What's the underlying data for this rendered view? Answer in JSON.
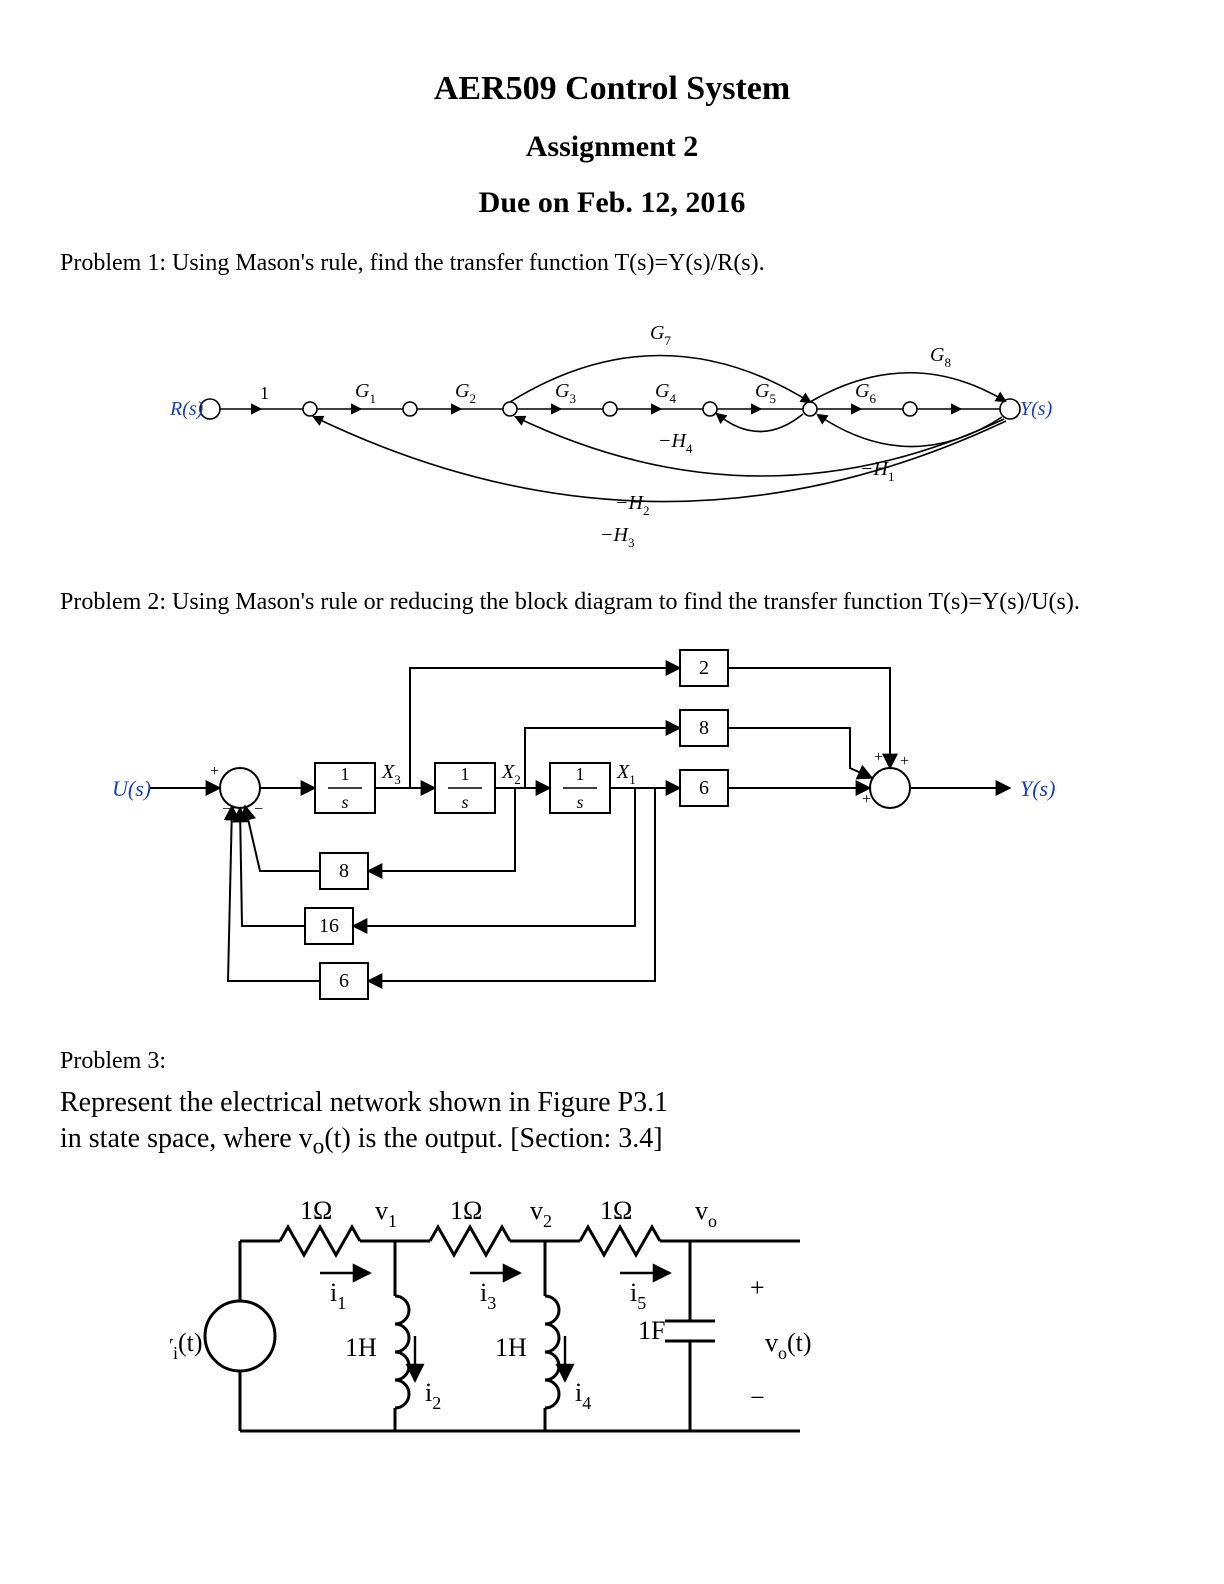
{
  "header": {
    "course": "AER509 Control System",
    "assign": "Assignment 2",
    "due": "Due on Feb. 12, 2016"
  },
  "problem1": {
    "text": "Problem 1:  Using Mason's rule, find the transfer function T(s)=Y(s)/R(s).",
    "labels": {
      "Rs": "R(s)",
      "Ys": "Y(s)",
      "one": "1",
      "G1": "G",
      "G1s": "1",
      "G2": "G",
      "G2s": "2",
      "G3": "G",
      "G3s": "3",
      "G4": "G",
      "G4s": "4",
      "G5": "G",
      "G5s": "5",
      "G6": "G",
      "G6s": "6",
      "G7": "G",
      "G7s": "7",
      "G8": "G",
      "G8s": "8",
      "mH1": "−H",
      "mH1s": "1",
      "mH2": "−H",
      "mH2s": "2",
      "mH3": "−H",
      "mH3s": "3",
      "mH4": "−H",
      "mH4s": "4"
    }
  },
  "problem2": {
    "text": "Problem 2: Using Mason's rule or reducing the block diagram to find the transfer function T(s)=Y(s)/U(s).",
    "labels": {
      "Us": "U(s)",
      "Ys": "Y(s)",
      "int": "1",
      "ints": "s",
      "X1": "X",
      "X1s": "1",
      "X2": "X",
      "X2s": "2",
      "X3": "X",
      "X3s": "3",
      "b8": "8",
      "b16": "16",
      "b6": "6",
      "fb8": "8",
      "f2": "2",
      "f6": "6",
      "plus": "+",
      "minus": "−"
    }
  },
  "problem3": {
    "title": "Problem 3:",
    "line1": "Represent the electrical network shown in Figure P3.1",
    "line2": "in state space, where v",
    "line2sub": "o",
    "line2b": "(t) is the output. [Section: 3.4]",
    "labels": {
      "R": "1Ω",
      "L": "1H",
      "C": "1F",
      "v1": "v",
      "v1s": "1",
      "v2": "v",
      "v2s": "2",
      "vo": "v",
      "vos": "o",
      "i1": "i",
      "i1s": "1",
      "i2": "i",
      "i2s": "2",
      "i3": "i",
      "i3s": "3",
      "i4": "i",
      "i4s": "4",
      "i5": "i",
      "i5s": "5",
      "vit": "v",
      "vits": "i",
      "vitb": "(t)",
      "vot": "v",
      "vots": "o",
      "votb": "(t)",
      "plus": "+",
      "minus": "−"
    }
  }
}
